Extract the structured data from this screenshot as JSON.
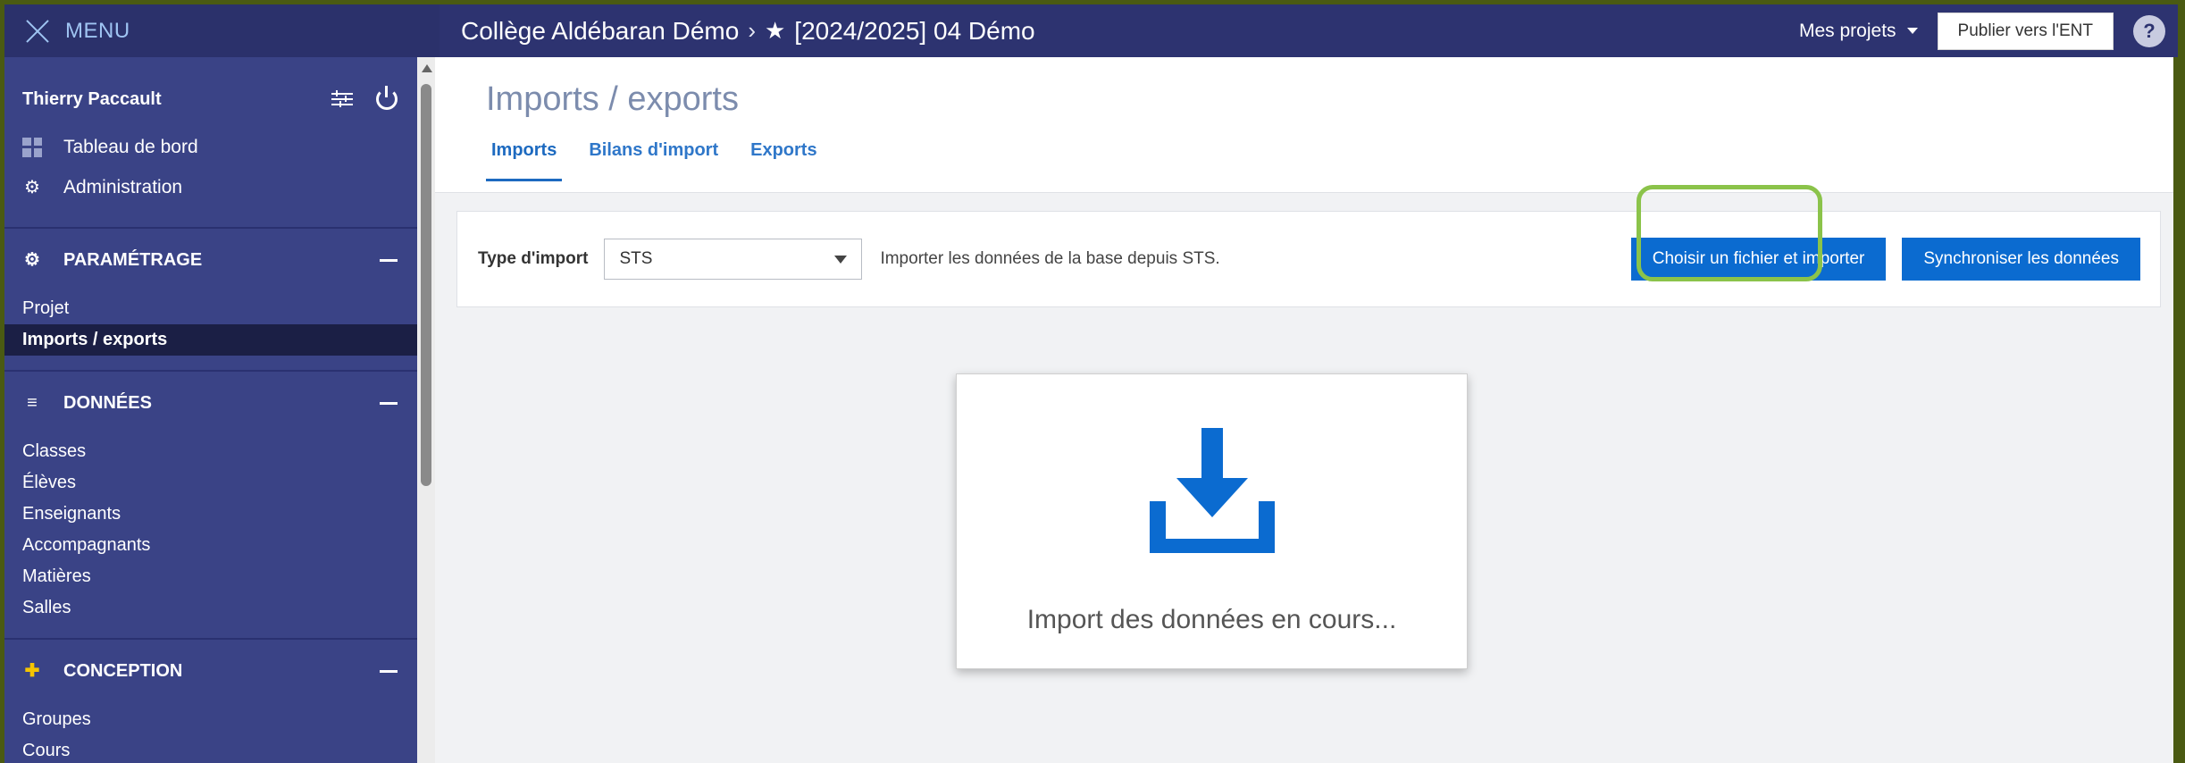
{
  "topbar": {
    "menu_label": "MENU",
    "school": "Collège Aldébaran Démo",
    "separator": "›",
    "project": "[2024/2025] 04 Démo",
    "my_projects": "Mes projets",
    "publish": "Publier vers l'ENT",
    "help": "?"
  },
  "sidebar": {
    "user": "Thierry Paccault",
    "links": [
      {
        "label": "Tableau de bord"
      },
      {
        "label": "Administration"
      }
    ],
    "sections": [
      {
        "title": "PARAMÉTRAGE",
        "items": [
          "Projet",
          "Imports / exports"
        ]
      },
      {
        "title": "DONNÉES",
        "items": [
          "Classes",
          "Élèves",
          "Enseignants",
          "Accompagnants",
          "Matières",
          "Salles"
        ]
      },
      {
        "title": "CONCEPTION",
        "items": [
          "Groupes",
          "Cours"
        ]
      }
    ]
  },
  "main": {
    "title": "Imports / exports",
    "tabs": [
      "Imports",
      "Bilans d'import",
      "Exports"
    ],
    "type_label": "Type d'import",
    "type_value": "STS",
    "description": "Importer les données de la base depuis STS.",
    "choose_button": "Choisir un fichier et importer",
    "sync_button": "Synchroniser les données",
    "progress_text": "Import des données en cours..."
  },
  "colors": {
    "topbar": "#2d3370",
    "sidebar": "#3a4386",
    "primary_button": "#0b6bd0",
    "highlight": "#8bc34a"
  }
}
